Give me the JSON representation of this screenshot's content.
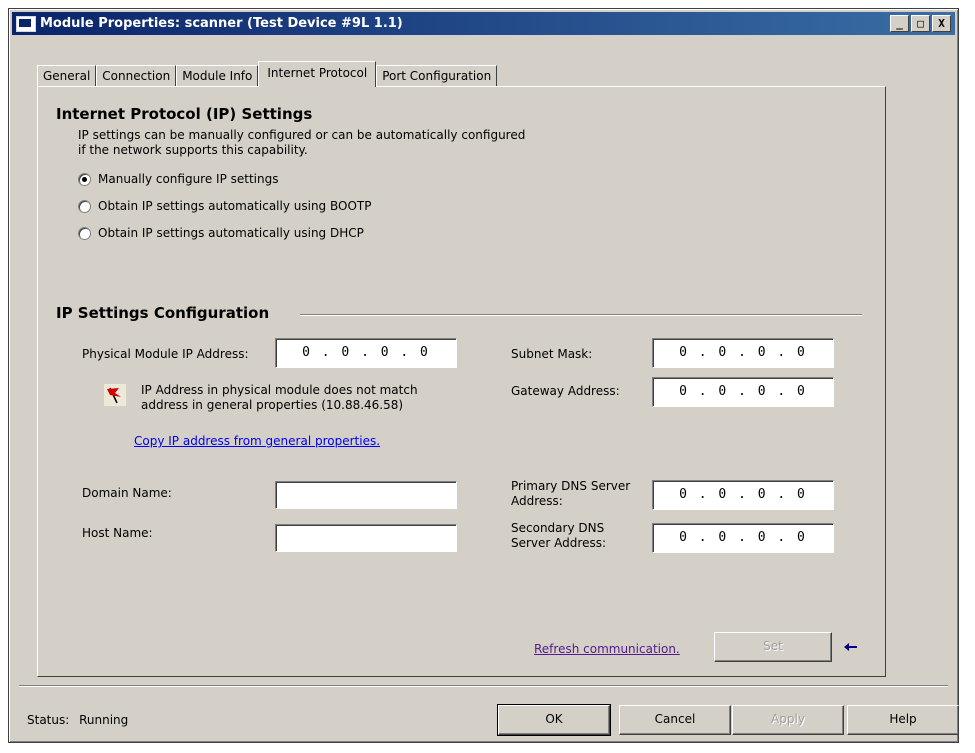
{
  "window": {
    "title": "Module Properties: scanner (Test Device #9L 1.1)",
    "minimize": "_",
    "maximize": "□",
    "close": "X"
  },
  "tabs": [
    {
      "label": "General",
      "active": false
    },
    {
      "label": "Connection",
      "active": false
    },
    {
      "label": "Module Info",
      "active": false
    },
    {
      "label": "Internet Protocol",
      "active": true
    },
    {
      "label": "Port Configuration",
      "active": false
    }
  ],
  "ip_section": {
    "title": "Internet Protocol (IP) Settings",
    "description_line1": "IP settings can be manually configured or can be automatically configured",
    "description_line2": "if the network supports this capability.",
    "options": [
      {
        "label": "Manually configure IP settings",
        "checked": true
      },
      {
        "label": "Obtain IP settings automatically using BOOTP",
        "checked": false
      },
      {
        "label": "Obtain IP settings automatically using DHCP",
        "checked": false
      }
    ]
  },
  "config_section": {
    "title": "IP Settings Configuration",
    "physical_ip_label": "Physical Module IP Address:",
    "physical_ip_value": "0 . 0 . 0 . 0",
    "warning_line1": "IP Address in physical module does not match",
    "warning_line2": "address in general properties (10.88.46.58)",
    "copy_link": "Copy IP address from general properties.",
    "subnet_label": "Subnet Mask:",
    "subnet_value": "0 . 0 . 0 . 0",
    "gateway_label": "Gateway Address:",
    "gateway_value": "0 . 0 . 0 . 0",
    "domain_label": "Domain Name:",
    "domain_value": "",
    "host_label": "Host Name:",
    "host_value": "",
    "primary_dns_label_line1": "Primary DNS Server",
    "primary_dns_label_line2": "Address:",
    "primary_dns_value": "0 . 0 . 0 . 0",
    "secondary_dns_label_line1": "Secondary DNS",
    "secondary_dns_label_line2": "Server Address:",
    "secondary_dns_value": "0 . 0 . 0 . 0",
    "refresh_link": "Refresh communication.",
    "set_button": "Set"
  },
  "footer": {
    "status_label": "Status:",
    "status_value": "Running",
    "ok": "OK",
    "cancel": "Cancel",
    "apply": "Apply",
    "help": "Help"
  },
  "icons": {
    "flag": "warning-flag-icon",
    "arrow": "left-arrow-icon"
  },
  "colors": {
    "title_bar_start": "#0a246a",
    "title_bar_end": "#3a6ea5",
    "dialog_face": "#d4d0c8",
    "link_blue": "#0000ee",
    "link_visited": "#551a8b"
  }
}
